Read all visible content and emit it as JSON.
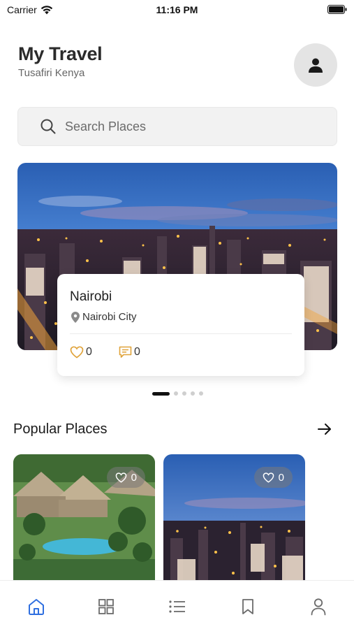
{
  "status_bar": {
    "carrier": "Carrier",
    "time": "11:16 PM"
  },
  "header": {
    "title": "My Travel",
    "subtitle": "Tusafiri Kenya"
  },
  "search": {
    "placeholder": "Search Places"
  },
  "featured": {
    "name": "Nairobi",
    "location": "Nairobi City",
    "likes": "0",
    "comments": "0",
    "carousel_pages": 5,
    "active_page": 1
  },
  "popular": {
    "title": "Popular Places",
    "items": [
      {
        "likes": "0"
      },
      {
        "likes": "0"
      }
    ]
  },
  "tabbar": {
    "items": [
      "home-icon",
      "grid-icon",
      "list-icon",
      "bookmark-icon",
      "profile-icon"
    ],
    "active": "home-icon"
  },
  "colors": {
    "accent": "#2f6fe0",
    "like_icon": "#e0a33a",
    "comment_icon": "#e0a33a"
  }
}
